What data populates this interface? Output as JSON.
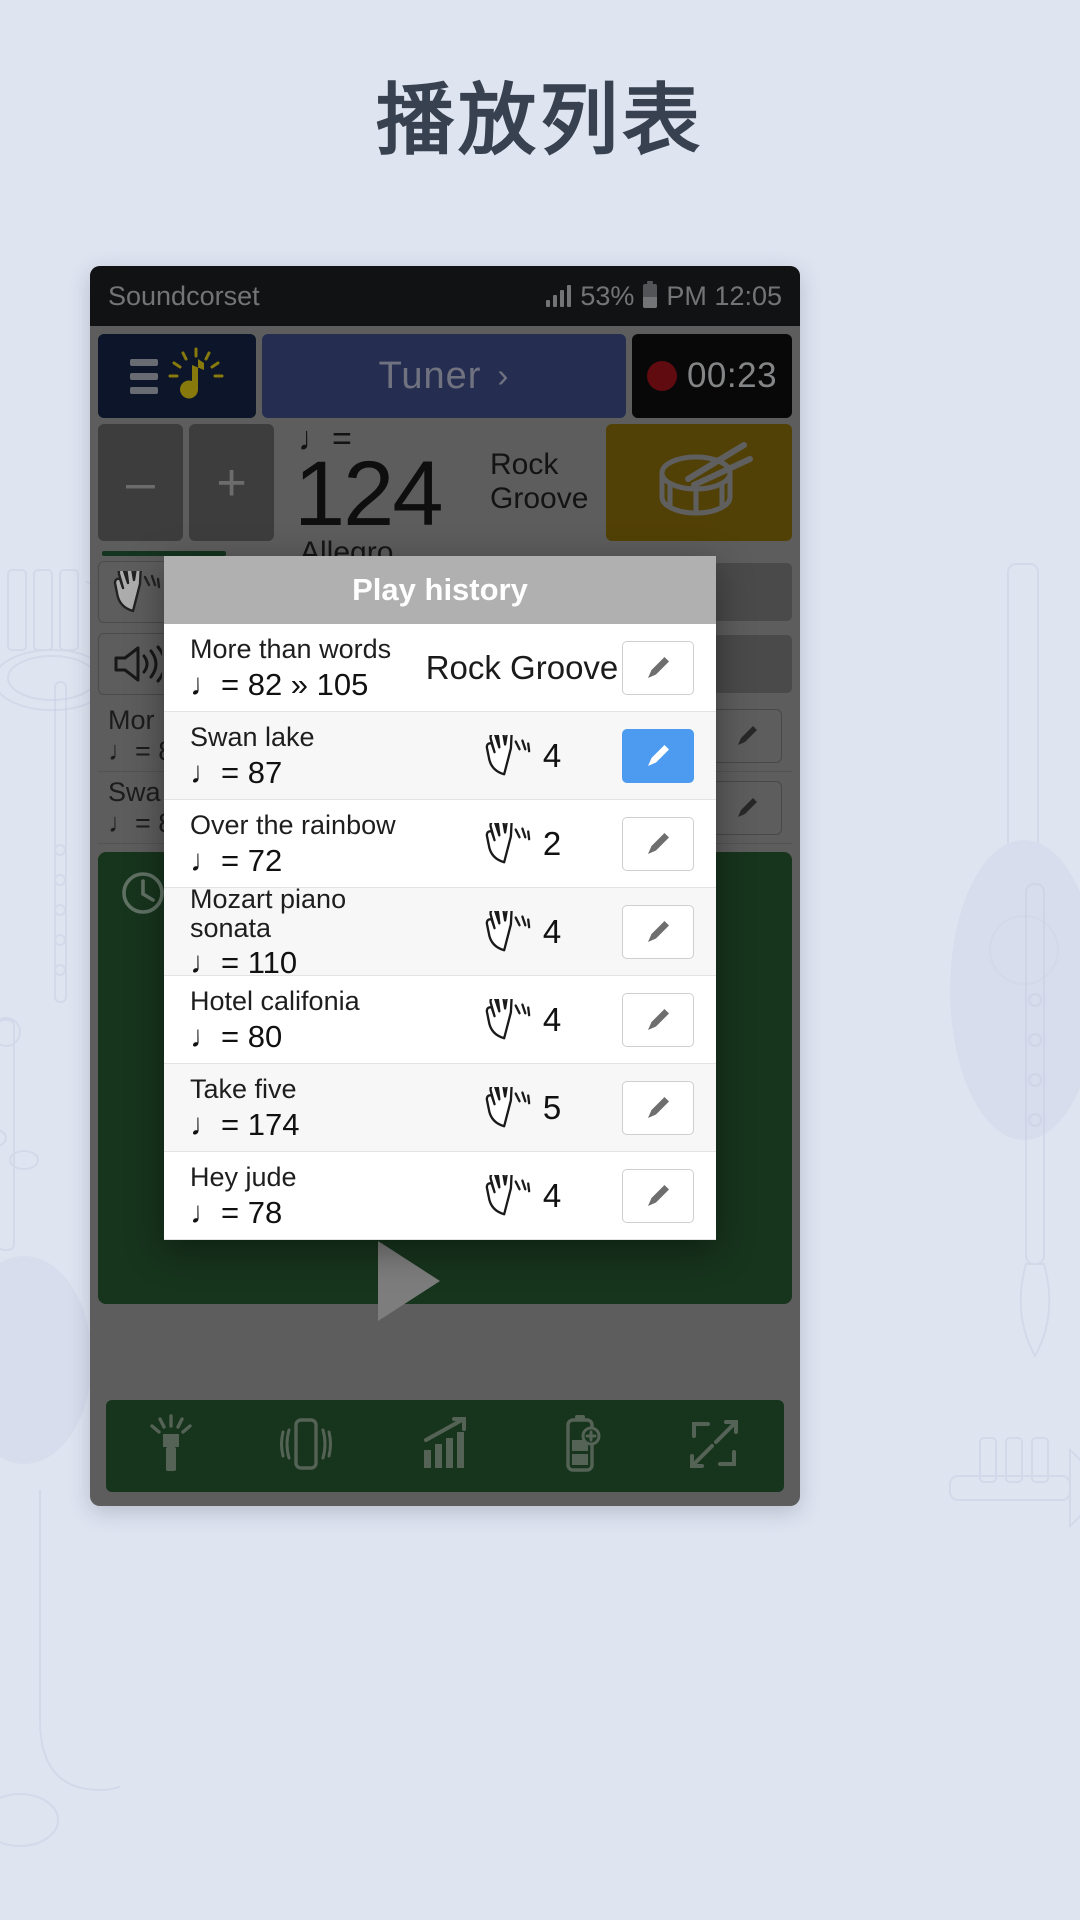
{
  "page": {
    "title": "播放列表"
  },
  "status_bar": {
    "app_name": "Soundcorset",
    "battery_percent": "53%",
    "time": "PM 12:05",
    "signal_icon": "signal-bars-icon",
    "battery_icon": "battery-icon"
  },
  "toolbar": {
    "menu_icon": "hamburger-menu-icon",
    "metronome_icon": "metronome-note-icon",
    "tuner_label": "Tuner",
    "tuner_chevron": "›",
    "record_icon": "record-dot-icon",
    "record_time": "00:23"
  },
  "tempo": {
    "minus_label": "–",
    "plus_label": "+",
    "note_symbol": "♩=",
    "bpm": "124",
    "marking": "Allegro",
    "groove_line1": "Rock",
    "groove_line2": "Groove",
    "drum_icon": "snare-drum-icon"
  },
  "background_panel": {
    "clap_icon": "clapping-hands-icon",
    "speaker_icon": "speaker-volume-icon",
    "clock_icon": "clock-icon",
    "rows": [
      {
        "title": "Mor",
        "bpm": "♩= 8"
      },
      {
        "title": "Swa",
        "bpm": "♩= 8"
      }
    ]
  },
  "dialog": {
    "title": "Play history",
    "edit_icon": "pencil-edit-icon",
    "clap_icon": "clapping-hands-icon",
    "rows": [
      {
        "title": "More than words",
        "bpm": "♩= 82 » 105",
        "meta_text": "Rock Groove",
        "meta_type": "groove",
        "count": "",
        "active": false
      },
      {
        "title": "Swan lake",
        "bpm": "♩= 87",
        "meta_text": "",
        "meta_type": "clap",
        "count": "4",
        "active": true
      },
      {
        "title": "Over the rainbow",
        "bpm": "♩= 72",
        "meta_text": "",
        "meta_type": "clap",
        "count": "2",
        "active": false
      },
      {
        "title": "Mozart piano sonata",
        "bpm": "♩= 110",
        "meta_text": "",
        "meta_type": "clap",
        "count": "4",
        "active": false
      },
      {
        "title": "Hotel califonia",
        "bpm": "♩= 80",
        "meta_text": "",
        "meta_type": "clap",
        "count": "4",
        "active": false
      },
      {
        "title": "Take five",
        "bpm": "♩= 174",
        "meta_text": "",
        "meta_type": "clap",
        "count": "5",
        "active": false
      },
      {
        "title": "Hey jude",
        "bpm": "♩= 78",
        "meta_text": "",
        "meta_type": "clap",
        "count": "4",
        "active": false
      }
    ]
  },
  "bottom_bar": {
    "items": [
      {
        "icon": "flashlight-icon"
      },
      {
        "icon": "vibrate-phone-icon"
      },
      {
        "icon": "bar-chart-trend-icon"
      },
      {
        "icon": "battery-boost-icon"
      },
      {
        "icon": "expand-fullscreen-icon"
      }
    ]
  },
  "colors": {
    "page_bg": "#dfe4f1",
    "title": "#37414f",
    "phone_bezel": "#8a8a8a",
    "statusbar": "#191b1d",
    "menu_btn": "#12203d",
    "tuner_btn": "#374478",
    "record_btn": "#0c0c0c",
    "drum_pad": "#7a6109",
    "green_panel": "#234d2c",
    "dialog_header": "#b0b0b0",
    "active_edit": "#4d9bf0"
  }
}
